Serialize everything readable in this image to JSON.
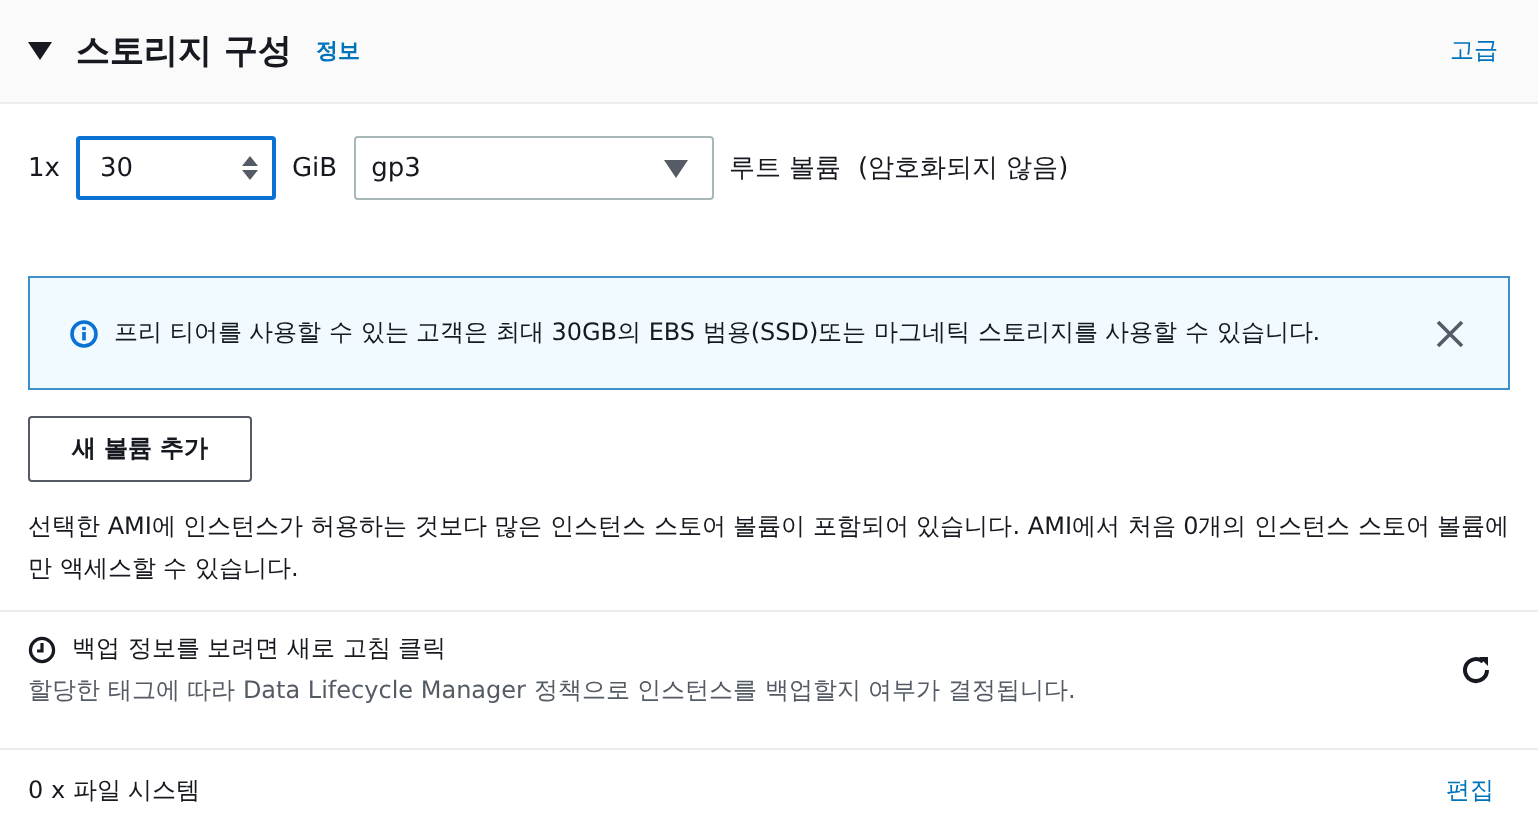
{
  "section": {
    "title": "스토리지 구성",
    "expanded": true,
    "info_link": "정보",
    "advanced_link": "고급"
  },
  "volume": {
    "count": "1x",
    "size": "30",
    "unit": "GiB",
    "type": "gp3",
    "description": "루트 볼륨  (암호화되지 않음)"
  },
  "alert": {
    "message": "프리 티어를 사용할 수 있는 고객은 최대 30GB의 EBS 범용(SSD)또는 마그네틱 스토리지를 사용할 수 있습니다."
  },
  "add_volume_button": "새 볼륨 추가",
  "note": "선택한 AMI에 인스턴스가 허용하는 것보다 많은 인스턴스 스토어 볼륨이 포함되어 있습니다. AMI에서 처음 0개의 인스턴스 스토어 볼륨에만 액세스할 수 있습니다.",
  "backup": {
    "title": "백업 정보를 보려면 새로 고침 클릭",
    "description": "할당한 태그에 따라 Data Lifecycle Manager 정책으로 인스턴스를 백업할지 여부가 결정됩니다."
  },
  "file_systems": {
    "label": "0 x 파일 시스템",
    "edit_link": "편집"
  }
}
